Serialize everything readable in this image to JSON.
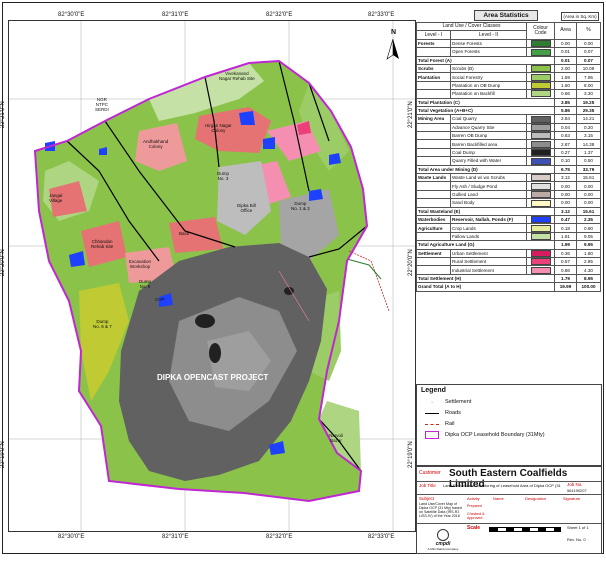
{
  "map": {
    "title": "DIPKA OPENCAST PROJECT",
    "north_label": "N",
    "x_ticks": [
      "82°30'0\"E",
      "82°31'0\"E",
      "82°32'0\"E",
      "82°33'0\"E"
    ],
    "y_ticks": [
      "22°21'0\"N",
      "22°20'0\"N",
      "22°19'0\"N"
    ],
    "labels": [
      {
        "id": "vivekanand",
        "text": "Vivekanand\nNagar Rehab Site"
      },
      {
        "id": "ngr",
        "text": "NGR\nNTPC\nSERDI"
      },
      {
        "id": "dumpno3",
        "text": "Dump\nNo. 3"
      },
      {
        "id": "dump12",
        "text": "Dump\nNo. 1 & 2"
      },
      {
        "id": "dump67",
        "text": "Dump\nNo. 6 & 7"
      },
      {
        "id": "dump5",
        "text": "Dump\nNo. 5"
      },
      {
        "id": "chp",
        "text": "CHP"
      },
      {
        "id": "excav",
        "text": "Excavation\nWorkshop"
      },
      {
        "id": "basti",
        "text": "Basti"
      },
      {
        "id": "officer",
        "text": "Dipka Bill\nOffice"
      },
      {
        "id": "narvoli",
        "text": "Narvoli\nBazar"
      },
      {
        "id": "hvnagar",
        "text": "Hirgan Nagar\nColony"
      },
      {
        "id": "rehab",
        "text": "Chhandan\nRehab Site"
      },
      {
        "id": "ahsnagar",
        "text": "Andhakhand\nColony"
      },
      {
        "id": "jangal",
        "text": "Jangal\nVillage"
      }
    ]
  },
  "area_statistics": {
    "title": "Area Statistics",
    "unit": "(Area in Sq. Km)",
    "headers": {
      "class": "Land Use / Cover Classes",
      "level1": "Level - I",
      "level2": "Level - II",
      "colour": "Colour Code",
      "area": "Area",
      "pct": "%"
    },
    "rows": [
      {
        "l1": "Forests",
        "l2": "Dense Forests",
        "color": "#2e7d32",
        "area": "0.00",
        "pct": "0.00"
      },
      {
        "l1": "",
        "l2": "Open Forests",
        "color": "#43a047",
        "area": "0.01",
        "pct": "0.07"
      },
      {
        "total": true,
        "l2": "Total Forest (A)",
        "area": "0.01",
        "pct": "0.07"
      },
      {
        "l1": "Scrubs",
        "l2": "Scrubs (B)",
        "color": "#8bc34a",
        "area": "2.00",
        "pct": "10.09"
      },
      {
        "l1": "Plantation",
        "l2": "Social Forestry",
        "color": "#9ccc65",
        "area": "1.59",
        "pct": "7.95"
      },
      {
        "l1": "",
        "l2": "Plantation on OB Dump",
        "color": "#c0ca33",
        "area": "1.60",
        "pct": "8.00"
      },
      {
        "l1": "",
        "l2": "Plantation on Backfill",
        "color": "#aed581",
        "area": "0.66",
        "pct": "3.30"
      },
      {
        "total": true,
        "l2": "Total Plantation (C)",
        "area": "3.85",
        "pct": "19.25"
      },
      {
        "total": true,
        "l2": "Total Vegetation (A+B+C)",
        "area": "5.86",
        "pct": "29.35"
      },
      {
        "l1": "Mining Area",
        "l2": "Coal Quarry",
        "color": "#616161",
        "area": "2.84",
        "pct": "14.21"
      },
      {
        "l1": "",
        "l2": "Advance Quarry Site",
        "color": "#9e9e9e",
        "area": "0.04",
        "pct": "0.20"
      },
      {
        "l1": "",
        "l2": "Barren OB Dump",
        "color": "#bdbdbd",
        "area": "0.63",
        "pct": "3.15"
      },
      {
        "l1": "",
        "l2": "Barren Backfilled area",
        "color": "#8d8d8d",
        "area": "2.87",
        "pct": "14.38"
      },
      {
        "l1": "",
        "l2": "Coal Dump",
        "color": "#212121",
        "area": "0.27",
        "pct": "1.37"
      },
      {
        "l1": "",
        "l2": "Quarry Filled with Water",
        "color": "#3f51b5",
        "area": "0.10",
        "pct": "0.50"
      },
      {
        "total": true,
        "l2": "Total Area under Mining (D)",
        "area": "6.75",
        "pct": "33.79"
      },
      {
        "l1": "Waste Lands",
        "l2": "Waste Land w/ wo Scrubs",
        "color": "#d7ccc8",
        "area": "3.12",
        "pct": "15.61"
      },
      {
        "l1": "",
        "l2": "Fly Ash / Sludge Pond",
        "color": "#e0e0e0",
        "area": "0.00",
        "pct": "0.00"
      },
      {
        "l1": "",
        "l2": "Gullied Land",
        "color": "#bcaaa4",
        "area": "0.00",
        "pct": "0.00"
      },
      {
        "l1": "",
        "l2": "Sand Body",
        "color": "#fff9c4",
        "area": "0.00",
        "pct": "0.00"
      },
      {
        "total": true,
        "l2": "Total Wasteland (E)",
        "area": "3.12",
        "pct": "15.61"
      },
      {
        "l1": "Waterbodies",
        "l2": "Reservoir, Nallah, Ponds (F)",
        "color": "#1e40ff",
        "area": "0.47",
        "pct": "2.35",
        "bold": true
      },
      {
        "l1": "Agriculture",
        "l2": "Crop Lands",
        "color": "#e6ee9c",
        "area": "0.18",
        "pct": "0.90"
      },
      {
        "l1": "",
        "l2": "Fallow Lands",
        "color": "#c5e1a5",
        "area": "1.81",
        "pct": "9.05"
      },
      {
        "total": true,
        "l2": "Total Agriculture Land (G)",
        "area": "1.99",
        "pct": "9.95"
      },
      {
        "l1": "Settlement",
        "l2": "Urban Settlement",
        "color": "#d81b60",
        "area": "0.36",
        "pct": "1.80"
      },
      {
        "l1": "",
        "l2": "Rural Settlement",
        "color": "#ec407a",
        "area": "0.57",
        "pct": "2.85"
      },
      {
        "l1": "",
        "l2": "Industrial Settlement",
        "color": "#f48fb1",
        "area": "0.86",
        "pct": "4.30"
      },
      {
        "total": true,
        "l2": "Total Settlement (H)",
        "area": "1.79",
        "pct": "8.95"
      },
      {
        "total": true,
        "l2": "Grand Total (A to H)",
        "area": "19.99",
        "pct": "100.00"
      }
    ]
  },
  "legend": {
    "title": "Legend",
    "items": [
      {
        "id": "settlement",
        "label": "Settlement"
      },
      {
        "id": "roads",
        "label": "Roads"
      },
      {
        "id": "rail",
        "label": "Rail"
      },
      {
        "id": "boundary",
        "label": "Dipka OCP Leasehold Boundary (31Mty)"
      }
    ]
  },
  "titleblock": {
    "customer_label": "Customer",
    "customer": "South Eastern Coalfields Limited",
    "job_title_label": "Job Title",
    "job_title": "Land Reclamation Monitoring of Leasehold Area of Dipka OCP (31 Mty)",
    "job_no_label": "Job No.",
    "job_no": "561190207",
    "subject_label": "Subject",
    "subject": "Land Use/Cover Map of Dipka OCP (31 Mty) based on Satellite Data (IRS-R2 LISS-IV) of the Year 2018",
    "activity_label": "Activity",
    "name_label": "Name",
    "designation_label": "Designation",
    "signature_label": "Signature",
    "prepared": "Prepared",
    "checked": "Checked &\nApproved",
    "scale_label": "Scale",
    "sheet_label": "Sheet 1 of 1",
    "rev_label": "Rev. No. 0",
    "logo_text": "cmpdi",
    "logo_sub": "A Mini Ratna Company"
  },
  "colors": {
    "boundary": "#c026d3",
    "road": "#000000",
    "rail": "#c62828",
    "water": "#1e40ff"
  }
}
